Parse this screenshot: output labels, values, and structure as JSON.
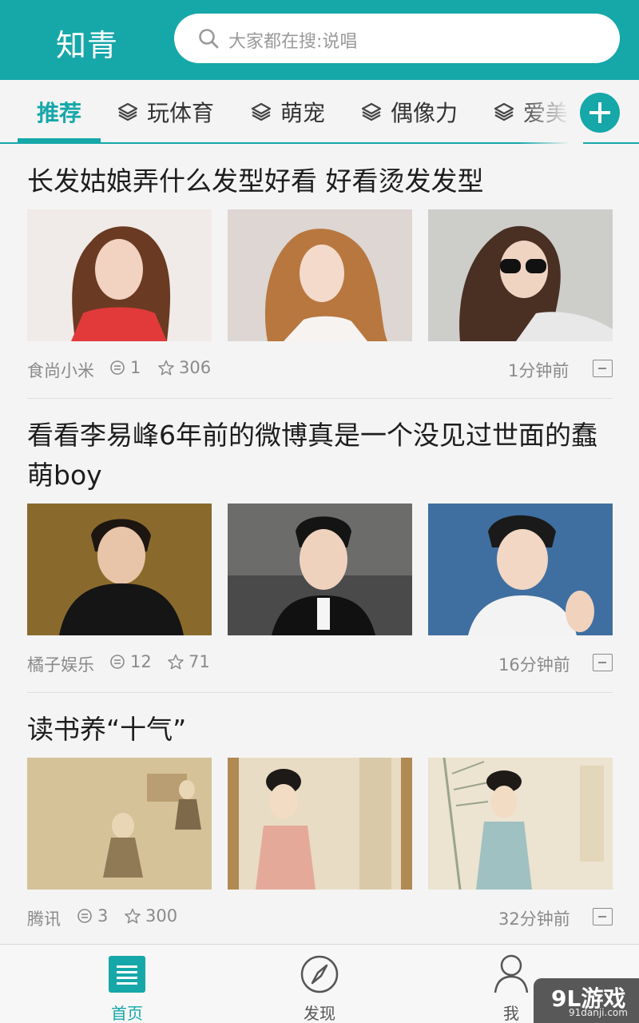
{
  "header": {
    "app_title": "知青",
    "search_placeholder": "大家都在搜:说唱"
  },
  "tabs": [
    "推荐",
    "玩体育",
    "萌宠",
    "偶像力",
    "爱美"
  ],
  "posts": [
    {
      "title": "长发姑娘弄什么发型好看 好看烫发发型",
      "source": "食尚小米",
      "comments": "1",
      "stars": "306",
      "time": "1分钟前"
    },
    {
      "title": "看看李易峰6年前的微博真是一个没见过世面的蠢萌boy",
      "source": "橘子娱乐",
      "comments": "12",
      "stars": "71",
      "time": "16分钟前"
    },
    {
      "title": "读书养“十气”",
      "source": "腾讯",
      "comments": "3",
      "stars": "300",
      "time": "32分钟前"
    }
  ],
  "bottom_nav": [
    "首页",
    "发现",
    "我"
  ],
  "watermark": {
    "main": "9L游戏",
    "sub": "91danji.com"
  },
  "colors": {
    "accent": "#16a7a9",
    "background": "#f4f4f4"
  }
}
